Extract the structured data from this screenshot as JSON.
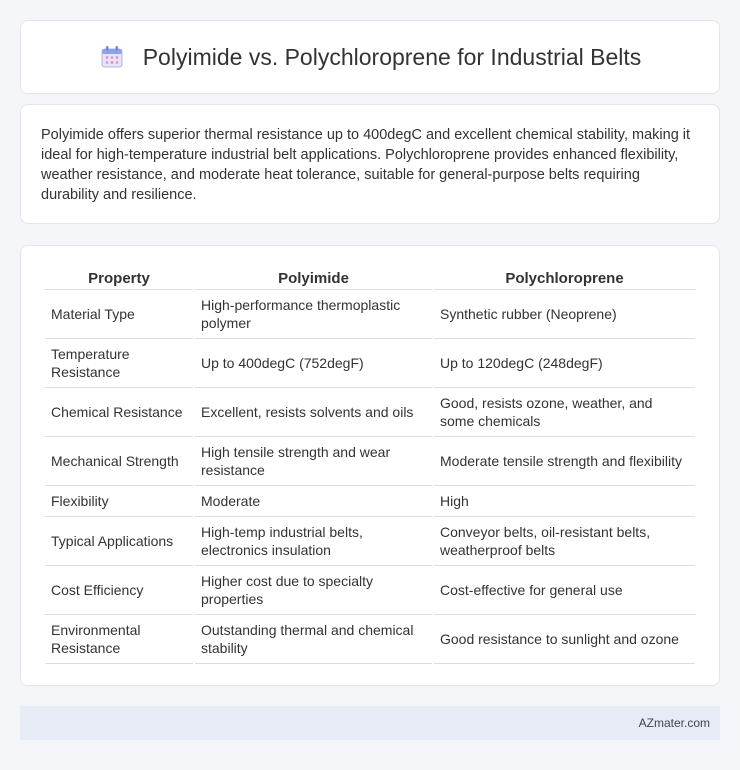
{
  "header": {
    "title": "Polyimide vs. Polychloroprene for Industrial Belts",
    "icon": "calendar-icon"
  },
  "intro": {
    "text": "Polyimide offers superior thermal resistance up to 400degC and excellent chemical stability, making it ideal for high-temperature industrial belt applications. Polychloroprene provides enhanced flexibility, weather resistance, and moderate heat tolerance, suitable for general-purpose belts requiring durability and resilience."
  },
  "table": {
    "headers": [
      "Property",
      "Polyimide",
      "Polychloroprene"
    ],
    "rows": [
      [
        "Material Type",
        "High-performance thermoplastic polymer",
        "Synthetic rubber (Neoprene)"
      ],
      [
        "Temperature Resistance",
        "Up to 400degC (752degF)",
        "Up to 120degC (248degF)"
      ],
      [
        "Chemical Resistance",
        "Excellent, resists solvents and oils",
        "Good, resists ozone, weather, and some chemicals"
      ],
      [
        "Mechanical Strength",
        "High tensile strength and wear resistance",
        "Moderate tensile strength and flexibility"
      ],
      [
        "Flexibility",
        "Moderate",
        "High"
      ],
      [
        "Typical Applications",
        "High-temp industrial belts, electronics insulation",
        "Conveyor belts, oil-resistant belts, weatherproof belts"
      ],
      [
        "Cost Efficiency",
        "Higher cost due to specialty properties",
        "Cost-effective for general use"
      ],
      [
        "Environmental Resistance",
        "Outstanding thermal and chemical stability",
        "Good resistance to sunlight and ozone"
      ]
    ]
  },
  "footer": {
    "brand": "AZmater.com"
  }
}
